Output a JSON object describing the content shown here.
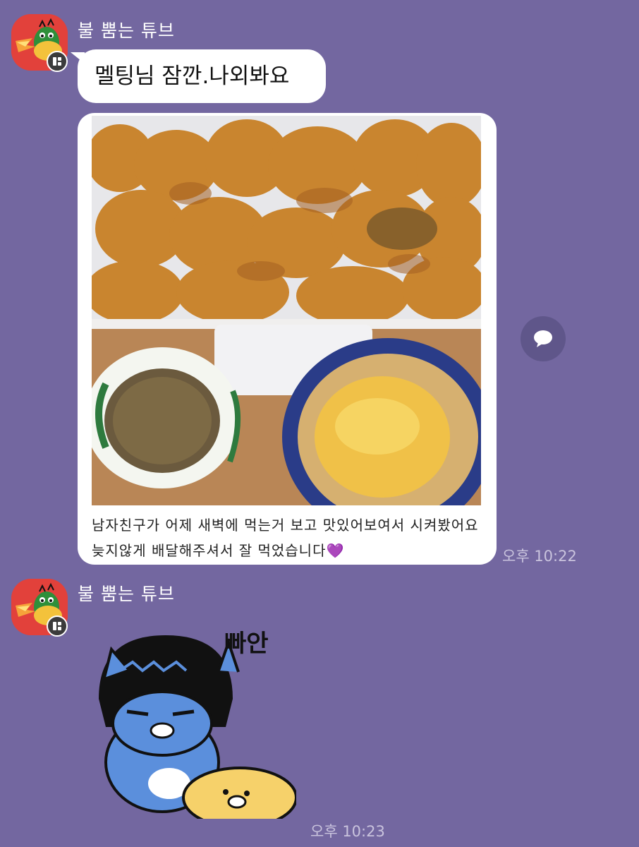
{
  "messages": [
    {
      "sender": "불 뿜는 튜브",
      "text": "멜팅님 잠깐.나외봐요"
    },
    {
      "caption_line1": "남자친구가 어제 새벽에 먹는거 보고 맛있어보여서 시켜봤어요",
      "caption_line2": "늦지않게 배달해주셔서 잘 먹었습니다",
      "caption_emoji": "💜",
      "time": "오후 10:22"
    },
    {
      "sender": "불 뿜는 튜브",
      "sticker_text": "빠안",
      "time": "오후 10:23"
    }
  ],
  "colors": {
    "background": "#7367a0",
    "bubble": "#ffffff",
    "avatar": "#e2413b"
  },
  "icons": {
    "profile_badge": "chat-profile-icon",
    "comment": "speech-bubble-icon"
  }
}
